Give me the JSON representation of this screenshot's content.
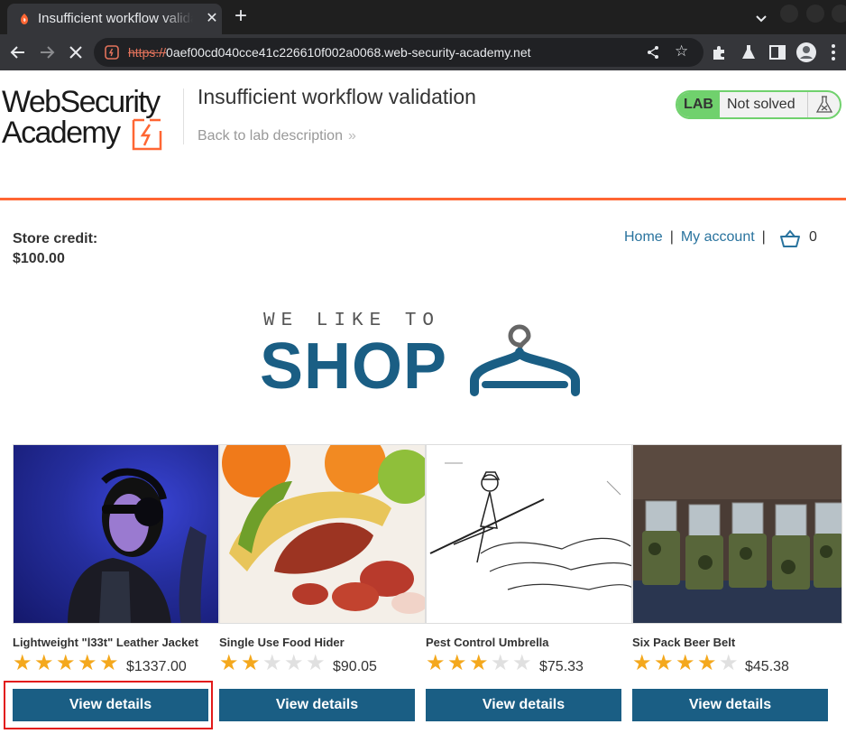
{
  "browser": {
    "tab_title": "Insufficient workflow validation",
    "url_scheme": "https://",
    "url_rest": "0aef00cd040cce41c226610f002a0068.web-security-academy.net"
  },
  "header": {
    "logo_line1": "WebSecurity",
    "logo_line2": "Academy",
    "lab_title": "Insufficient workflow validation",
    "back_link": "Back to lab description",
    "back_chevron": "»",
    "status_badge": "LAB",
    "status_text": "Not solved",
    "accent_color": "#ff6633",
    "status_color": "#70d16d"
  },
  "store": {
    "credit_label": "Store credit:",
    "credit_value": "$100.00",
    "nav": {
      "home": "Home",
      "separator": "|",
      "my_account": "My account",
      "cart_count": "0"
    },
    "banner_small": "WE LIKE TO",
    "banner_big": "SHOP",
    "button_color": "#1a5e84"
  },
  "products": [
    {
      "name": "Lightweight \"l33t\" Leather Jacket",
      "rating": 5,
      "max_rating": 5,
      "price": "$1337.00",
      "button": "View details",
      "image": "woman-with-headphones-photo"
    },
    {
      "name": "Single Use Food Hider",
      "rating": 2,
      "max_rating": 5,
      "price": "$90.05",
      "button": "View details",
      "image": "banana-sausage-photo"
    },
    {
      "name": "Pest Control Umbrella",
      "rating": 3,
      "max_rating": 5,
      "price": "$75.33",
      "button": "View details",
      "image": "cartoon-umbrella-sketch"
    },
    {
      "name": "Six Pack Beer Belt",
      "rating": 4,
      "max_rating": 5,
      "price": "$45.38",
      "button": "View details",
      "image": "beer-belt-photo"
    }
  ]
}
